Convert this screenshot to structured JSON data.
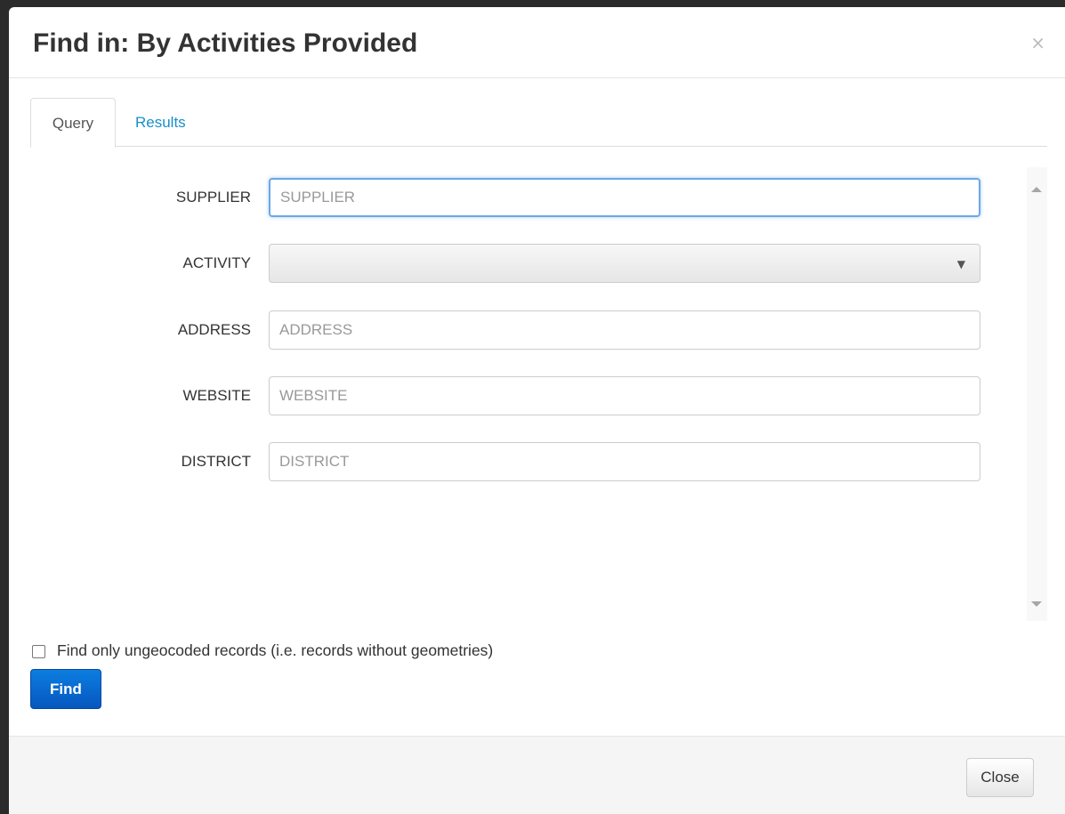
{
  "dialog": {
    "title": "Find in: By Activities Provided",
    "close_icon": "×"
  },
  "tabs": [
    {
      "label": "Query",
      "active": true
    },
    {
      "label": "Results",
      "active": false
    }
  ],
  "form": {
    "fields": [
      {
        "label": "SUPPLIER",
        "type": "text",
        "value": "",
        "placeholder": "SUPPLIER",
        "focused": true
      },
      {
        "label": "ACTIVITY",
        "type": "select",
        "value": "",
        "placeholder": ""
      },
      {
        "label": "ADDRESS",
        "type": "text",
        "value": "",
        "placeholder": "ADDRESS"
      },
      {
        "label": "WEBSITE",
        "type": "text",
        "value": "",
        "placeholder": "WEBSITE"
      },
      {
        "label": "DISTRICT",
        "type": "text",
        "value": "",
        "placeholder": "DISTRICT"
      }
    ],
    "select_arrow_icon": "▼"
  },
  "options": {
    "ungeocoded_label": "Find only ungeocoded records (i.e. records without geometries)",
    "ungeocoded_checked": false
  },
  "buttons": {
    "find_label": "Find",
    "close_label": "Close"
  },
  "colors": {
    "primary": "#0657bf",
    "link": "#1a8fc9",
    "focus": "#6ea6e8"
  }
}
